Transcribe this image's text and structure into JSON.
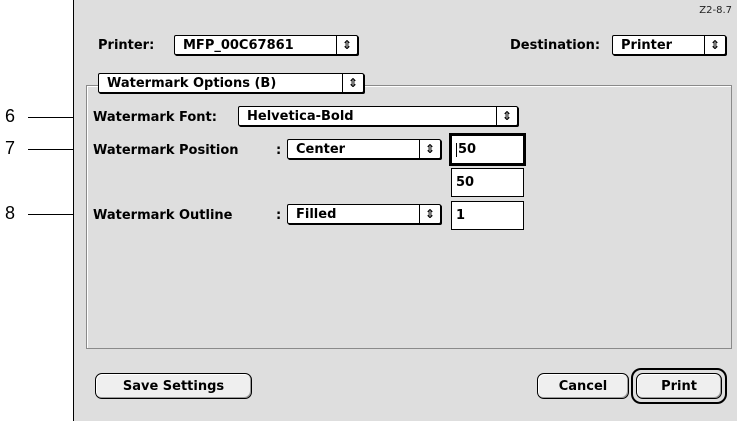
{
  "figure_ref": "Z2-8.7",
  "printer": {
    "label": "Printer:",
    "value": "MFP_00C67861",
    "arrow": "⇕"
  },
  "destination": {
    "label": "Destination:",
    "value": "Printer",
    "arrow": "⇕"
  },
  "panel_selector": {
    "value": "Watermark Options (B)",
    "arrow": "⇕"
  },
  "watermark_font": {
    "label": "Watermark Font:",
    "value": "Helvetica-Bold",
    "arrow": "⇕"
  },
  "watermark_position": {
    "label": "Watermark Position",
    "colon": ":",
    "value": "Center",
    "arrow": "⇕",
    "x_value": "50",
    "y_value": "50"
  },
  "watermark_outline": {
    "label": "Watermark Outline",
    "colon": ":",
    "value": "Filled",
    "arrow": "⇕",
    "width_value": "1"
  },
  "buttons": {
    "save": "Save Settings",
    "cancel": "Cancel",
    "print": "Print"
  },
  "callouts": [
    "6",
    "7",
    "8"
  ]
}
